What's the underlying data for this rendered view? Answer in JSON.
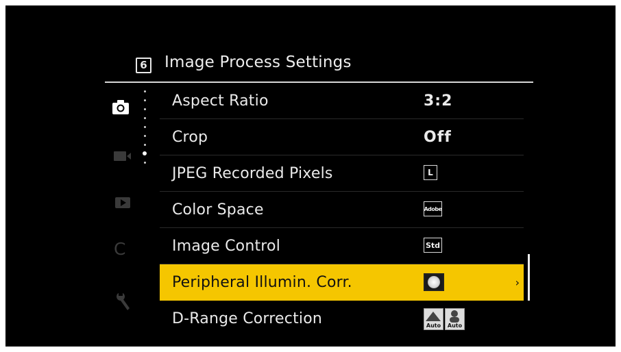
{
  "header": {
    "page_number": "6",
    "title": "Image Process Settings"
  },
  "tabs": {
    "camera_icon": "camera-icon",
    "video_icon": "video-camera-icon",
    "playback_icon": "playback-icon",
    "custom_label": "C",
    "setup_icon": "wrench-icon"
  },
  "menu": {
    "items": [
      {
        "label": "Aspect Ratio",
        "value": "3:2"
      },
      {
        "label": "Crop",
        "value": "Off"
      },
      {
        "label": "JPEG Recorded Pixels",
        "value": "L"
      },
      {
        "label": "Color Space",
        "value": "Adobe"
      },
      {
        "label": "Image Control",
        "value": "Std"
      },
      {
        "label": "Peripheral Illumin. Corr.",
        "value": "vignette-correction-icon",
        "chevron": "›"
      },
      {
        "label": "D-Range Correction",
        "value_left": "Auto",
        "value_right": "Auto"
      }
    ],
    "selected_index": 5
  },
  "colors": {
    "highlight": "#f5c600",
    "background": "#000000",
    "text": "#eaeaea"
  }
}
